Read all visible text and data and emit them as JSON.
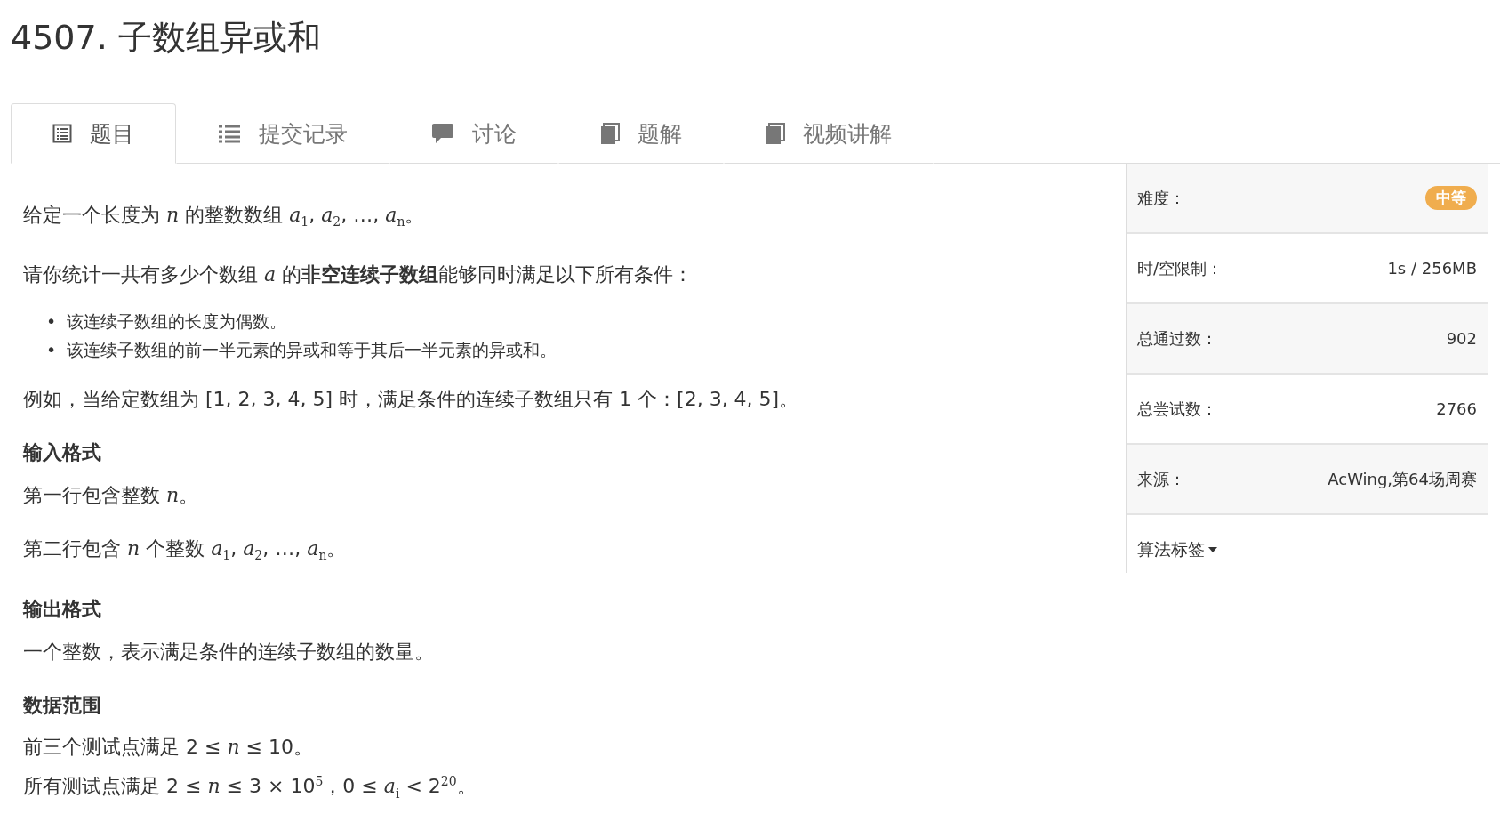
{
  "title": "4507. 子数组异或和",
  "tabs": [
    {
      "label": "题目",
      "kind": "document",
      "selected": true
    },
    {
      "label": "提交记录",
      "kind": "list",
      "selected": false
    },
    {
      "label": "讨论",
      "kind": "comment",
      "selected": false
    },
    {
      "label": "题解",
      "kind": "book",
      "selected": false
    },
    {
      "label": "视频讲解",
      "kind": "book",
      "selected": false
    }
  ],
  "content": [
    {
      "kind": "paragraph",
      "text": "给定一个长度为 *n* 的整数数组 *a*$_{1}$, *a*$_{2}$, …, *a*$_{n}$。"
    },
    {
      "kind": "paragraph",
      "text": "请你统计一共有多少个数组 *a* 的**非空连续子数组**能够同时满足以下所有条件："
    },
    {
      "kind": "list",
      "items": [
        {
          "marker": "•",
          "text": "该连续子数组的长度为偶数。"
        },
        {
          "marker": "•",
          "text": "该连续子数组的前一半元素的异或和等于其后一半元素的异或和。"
        }
      ]
    },
    {
      "kind": "paragraph",
      "text": "例如，当给定数组为 [1, 2, 3, 4, 5] 时，满足条件的连续子数组只有 1 个：[2, 3, 4, 5]。"
    },
    {
      "kind": "heading",
      "text": "输入格式"
    },
    {
      "kind": "paragraph",
      "text": "第一行包含整数 *n*。"
    },
    {
      "kind": "paragraph",
      "text": "第二行包含 *n* 个整数 *a*$_{1}$, *a*$_{2}$, …, *a*$_{n}$。"
    },
    {
      "kind": "heading",
      "text": "输出格式"
    },
    {
      "kind": "paragraph",
      "text": "一个整数，表示满足条件的连续子数组的数量。"
    },
    {
      "kind": "heading",
      "text": "数据范围"
    },
    {
      "kind": "lines",
      "items": [
        "前三个测试点满足 2 ≤ *n* ≤ 10。",
        "所有测试点满足 2 ≤ *n* ≤ 3 × 10$^{5}$，0 ≤ *a*$_{i}$ < 2$^{20}$。"
      ]
    }
  ],
  "sidebar": {
    "rows": [
      {
        "label": "难度：",
        "value": "中等",
        "kind": "badge",
        "color": "#f0ad4e"
      },
      {
        "label": "时/空限制：",
        "value": "1s / 256MB",
        "kind": "text"
      },
      {
        "label": "总通过数：",
        "value": "902",
        "kind": "text"
      },
      {
        "label": "总尝试数：",
        "value": "2766",
        "kind": "text"
      },
      {
        "label": "来源：",
        "value": "AcWing,第64场周赛",
        "kind": "text"
      }
    ],
    "tags_toggle": "算法标签"
  }
}
